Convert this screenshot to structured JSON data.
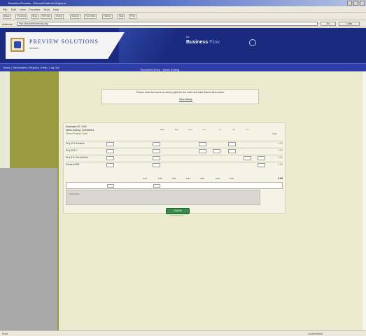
{
  "window": {
    "title": "Business Process - Microsoft Internet Explorer"
  },
  "menubar": {
    "items": [
      "File",
      "Edit",
      "View",
      "Favorites",
      "Tools",
      "Help"
    ]
  },
  "navbar": {
    "buttons": [
      "Back",
      "Forward",
      "Stop",
      "Refresh",
      "Home",
      "Search",
      "Favorites",
      "History",
      "Mail",
      "Print"
    ]
  },
  "addressbar": {
    "label": "Address",
    "value": "http://intranet/timeentry.asp",
    "go_label": "Go",
    "links_label": "Links"
  },
  "header": {
    "company_name": "PREVIEW SOLUTIONS",
    "company_sub": "Intranet",
    "product_pre": "the",
    "product_name": "Business",
    "product_name_suffix": "Flow"
  },
  "subnav": {
    "links": "Home  |  Timesheets  |  Reports  |  Help  |  Log Out",
    "page_title": "Timesheet Entry - Week Ending"
  },
  "info": {
    "text": "Please enter the hours for each project for the week and click Submit when done.",
    "link": "View history"
  },
  "form": {
    "head_line1": "Employee ID: 1042",
    "head_line2": "Week Ending: 10/15/2001",
    "head_line3": "Select Project Code",
    "col_headers": [
      "Mon",
      "Tue",
      "Wed",
      "Thu",
      "Fri",
      "Sat",
      "Sun",
      "Total"
    ],
    "rows": [
      {
        "label": "Proj 101-A Admin",
        "total": "0.00"
      },
      {
        "label": "Proj 204-C",
        "total": "0.00"
      },
      {
        "label": "Proj 311 Client Work",
        "total": "0.00"
      },
      {
        "label": "General 999",
        "total": "0.00"
      }
    ],
    "column_totals": [
      "0.00",
      "0.00",
      "0.00",
      "0.00",
      "0.00",
      "0.00",
      "0.00"
    ],
    "grand_total": "0.00",
    "gray_area_text": "Comments"
  },
  "actions": {
    "submit_label": "Submit"
  },
  "statusbar": {
    "text": "Done",
    "zone": "Local intranet"
  }
}
